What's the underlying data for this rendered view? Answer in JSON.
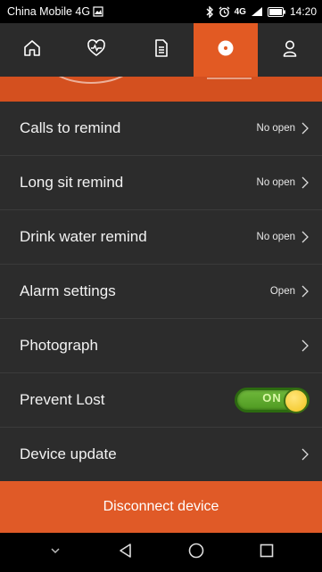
{
  "status_bar": {
    "carrier": "China Mobile 4G",
    "network": "4G",
    "time": "14:20"
  },
  "top_nav": {
    "tabs": [
      {
        "icon": "home-icon",
        "active": false
      },
      {
        "icon": "heart-rate-icon",
        "active": false
      },
      {
        "icon": "document-icon",
        "active": false
      },
      {
        "icon": "settings-icon",
        "active": true
      },
      {
        "icon": "user-icon",
        "active": false
      }
    ]
  },
  "settings": {
    "calls_to_remind": {
      "label": "Calls to remind",
      "status": "No open"
    },
    "long_sit_remind": {
      "label": "Long sit remind",
      "status": "No open"
    },
    "drink_water_remind": {
      "label": "Drink water remind",
      "status": "No open"
    },
    "alarm_settings": {
      "label": "Alarm settings",
      "status": "Open"
    },
    "photograph": {
      "label": "Photograph"
    },
    "prevent_lost": {
      "label": "Prevent Lost",
      "toggle": "ON"
    },
    "device_update": {
      "label": "Device update"
    }
  },
  "disconnect": {
    "label": "Disconnect device"
  },
  "colors": {
    "accent": "#e25a23",
    "background": "#2c2c2c",
    "toggle_on": "#5aa82a"
  }
}
